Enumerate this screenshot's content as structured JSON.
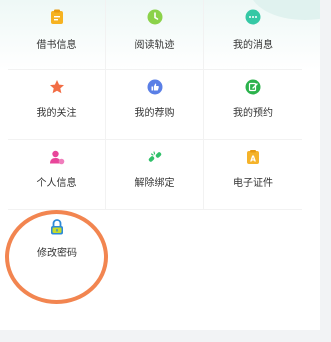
{
  "menu": {
    "rows": [
      [
        {
          "label": "借书信息",
          "icon": "clipboard-icon",
          "color": "#f6b221"
        },
        {
          "label": "阅读轨迹",
          "icon": "clock-icon",
          "color": "#8bd24a"
        },
        {
          "label": "我的消息",
          "icon": "chat-icon",
          "color": "#35c8a5"
        }
      ],
      [
        {
          "label": "我的关注",
          "icon": "star-icon",
          "color": "#f26d45"
        },
        {
          "label": "我的荐购",
          "icon": "thumbs-up-icon",
          "color": "#5a7fe6"
        },
        {
          "label": "我的预约",
          "icon": "edit-icon",
          "color": "#2bb24c"
        }
      ],
      [
        {
          "label": "个人信息",
          "icon": "user-icon",
          "color": "#e8459a"
        },
        {
          "label": "解除绑定",
          "icon": "unlink-icon",
          "color": "#30c06a"
        },
        {
          "label": "电子证件",
          "icon": "id-card-icon",
          "color": "#f5b32a"
        }
      ],
      [
        {
          "label": "修改密码",
          "icon": "lock-icon",
          "color": "#2d8ad8"
        }
      ]
    ]
  },
  "highlight_color": "#f28550"
}
